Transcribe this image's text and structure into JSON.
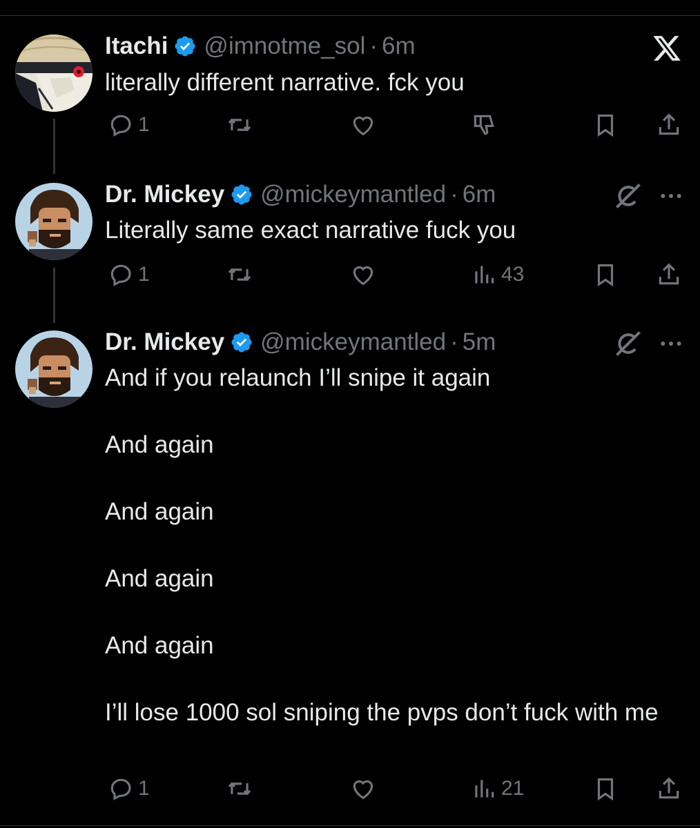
{
  "tweets": [
    {
      "name": "Itachi",
      "handle": "@imnotme_sol",
      "dot": "·",
      "time": "6m",
      "text": [
        "literally different narrative. fck you"
      ],
      "replies": "1",
      "views": ""
    },
    {
      "name": "Dr. Mickey",
      "handle": "@mickeymantled",
      "dot": "·",
      "time": "6m",
      "text": [
        "Literally same exact narrative fuck you"
      ],
      "replies": "1",
      "views": "43"
    },
    {
      "name": "Dr. Mickey",
      "handle": "@mickeymantled",
      "dot": "·",
      "time": "5m",
      "text": [
        "And if you relaunch I’ll snipe it again",
        "And again",
        "And again",
        "And again",
        "And again",
        "I’ll lose 1000 sol sniping the pvps don’t fuck with me"
      ],
      "replies": "1",
      "views": "21"
    }
  ],
  "colors": {
    "background": "#000000",
    "text": "#e7e9ea",
    "muted": "#71767b",
    "verified": "#1d9bf0"
  },
  "icons": [
    "x-logo-icon",
    "verified-badge-icon",
    "reply-icon",
    "retweet-icon",
    "like-icon",
    "dislike-icon",
    "views-icon",
    "bookmark-icon",
    "share-icon",
    "grok-icon",
    "more-icon"
  ]
}
